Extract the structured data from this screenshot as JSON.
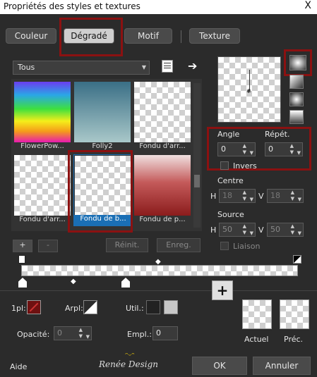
{
  "window": {
    "title": "Propriétés des styles et textures",
    "close": "X"
  },
  "tabs": [
    {
      "label": "Couleur"
    },
    {
      "label": "Dégradé"
    },
    {
      "label": "Motif"
    },
    {
      "label": "Texture"
    }
  ],
  "dropdown": {
    "value": "Tous"
  },
  "gallery": [
    {
      "label": "FlowerPow..."
    },
    {
      "label": "Folly2"
    },
    {
      "label": "Fondu d'arr..."
    },
    {
      "label": "Fondu d'arr..."
    },
    {
      "label": "Fondu de b..."
    },
    {
      "label": "Fondu de p..."
    }
  ],
  "gradient": {
    "angle_label": "Angle",
    "angle": "0",
    "repeat_label": "Répét.",
    "repeat": "0",
    "invert_label": "Invers",
    "center_label": "Centre",
    "center_h": "18",
    "center_v": "18",
    "source_label": "Source",
    "source_h": "50",
    "source_v": "50",
    "link_label": "Liaison",
    "h": "H",
    "v": "V"
  },
  "editor": {
    "add": "+",
    "remove": "-",
    "reset": "Réinit.",
    "save": "Enreg."
  },
  "props": {
    "pl_label": "1pl:",
    "arpl_label": "Arpl:",
    "util_label": "Util.:",
    "opacity_label": "Opacité:",
    "opacity": "0",
    "empl_label": "Empl.:",
    "empl": "0"
  },
  "preview": {
    "add": "+",
    "current": "Actuel",
    "previous": "Préc."
  },
  "footer": {
    "help": "Aide",
    "logo": "Renée Design",
    "ok": "OK",
    "cancel": "Annuler"
  },
  "colors": {
    "accent": "#8b1111",
    "select": "#1a6fb5"
  }
}
